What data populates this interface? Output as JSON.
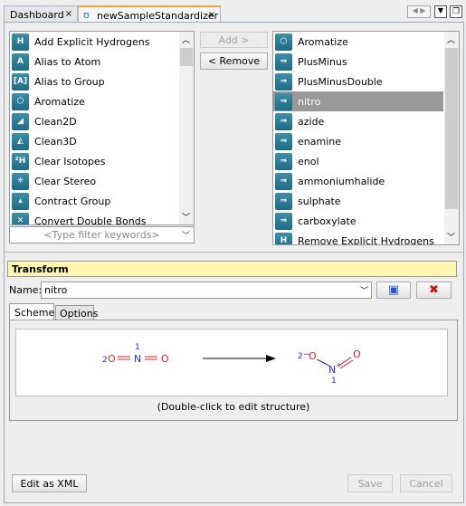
{
  "tabs": [
    {
      "label": "Dashboard",
      "close": "×"
    },
    {
      "label": "newSampleStandardizer",
      "close": "×"
    }
  ],
  "available": {
    "items": [
      {
        "label": "Add Explicit Hydrogens",
        "icon": "H"
      },
      {
        "label": "Alias to Atom",
        "icon": "A"
      },
      {
        "label": "Alias to Group",
        "icon": "[A]"
      },
      {
        "label": "Aromatize",
        "icon": "⬡"
      },
      {
        "label": "Clean2D",
        "icon": "◢"
      },
      {
        "label": "Clean3D",
        "icon": "◭"
      },
      {
        "label": "Clear Isotopes",
        "icon": "²H"
      },
      {
        "label": "Clear Stereo",
        "icon": "✳"
      },
      {
        "label": "Contract Group",
        "icon": "▴"
      },
      {
        "label": "Convert Double Bonds",
        "icon": "✕"
      }
    ],
    "filter_placeholder": "<Type filter keywords>"
  },
  "buttons": {
    "add": "Add >",
    "remove": "< Remove",
    "edit_xml": "Edit as XML",
    "save": "Save",
    "cancel": "Cancel"
  },
  "selected": {
    "items": [
      {
        "label": "Aromatize",
        "icon": "⬡"
      },
      {
        "label": "PlusMinus",
        "icon": "⇒"
      },
      {
        "label": "PlusMinusDouble",
        "icon": "⇒"
      },
      {
        "label": "nitro",
        "icon": "⇒",
        "selected": true
      },
      {
        "label": "azide",
        "icon": "⇒"
      },
      {
        "label": "enamine",
        "icon": "⇒"
      },
      {
        "label": "enol",
        "icon": "⇒"
      },
      {
        "label": "ammoniumhalide",
        "icon": "⇒"
      },
      {
        "label": "sulphate",
        "icon": "⇒"
      },
      {
        "label": "carboxylate",
        "icon": "⇒"
      },
      {
        "label": "Remove Explicit Hydrogens",
        "icon": "H"
      }
    ]
  },
  "transform": {
    "title": "Transform",
    "name_label": "Name:",
    "name_value": "nitro",
    "tabs": [
      "Scheme",
      "Options"
    ],
    "caption": "(Double-click to edit structure)"
  },
  "colors": {
    "header": "#fff7b0",
    "accent": "#1e6a85",
    "selected": "#999999"
  }
}
